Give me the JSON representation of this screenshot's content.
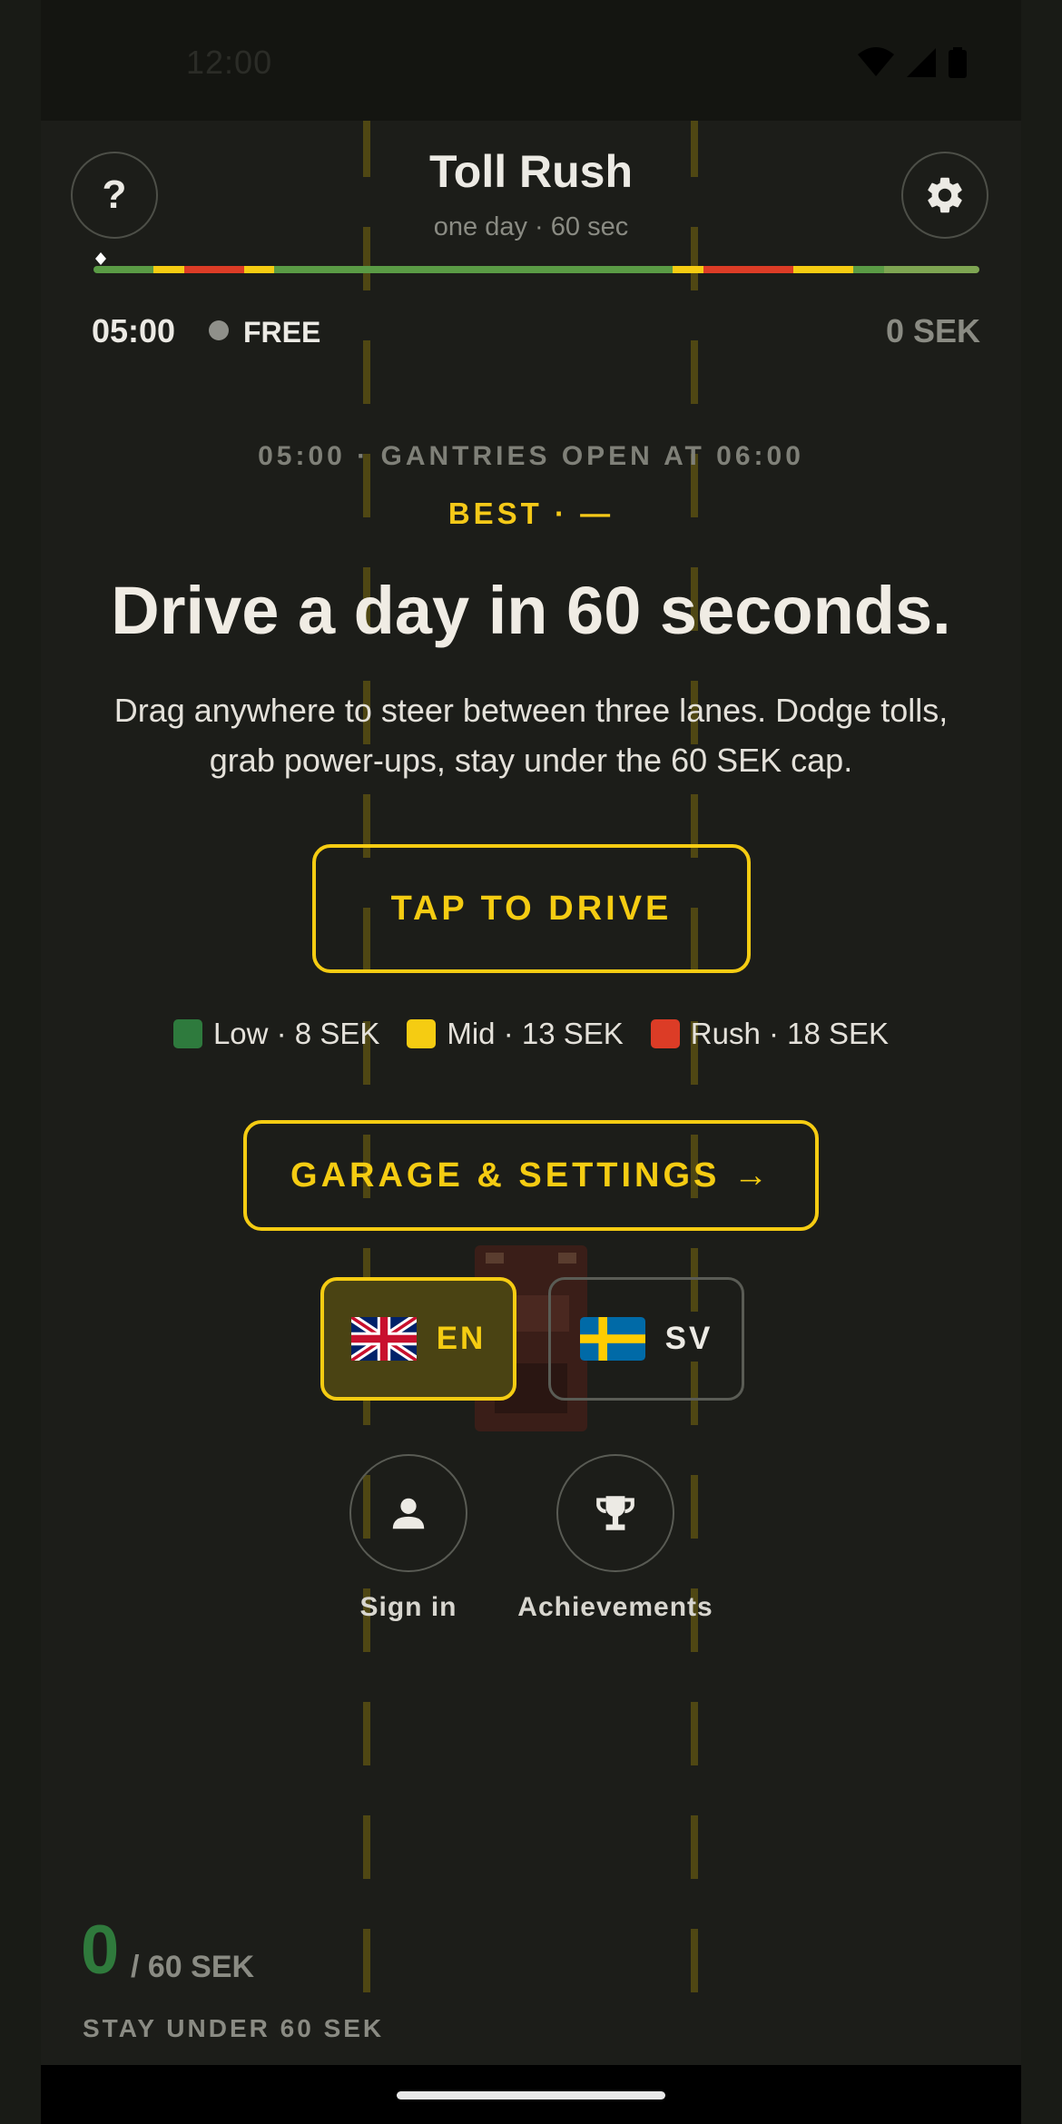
{
  "status_bar": {
    "time": "12:00",
    "icons": [
      "wifi-icon",
      "signal-icon",
      "battery-icon"
    ]
  },
  "header": {
    "help_label": "?",
    "title": "Toll Rush",
    "subtitle": "one day · 60 sec",
    "settings_icon": "gear-icon"
  },
  "timeline": {
    "segments": [
      {
        "tier": "low",
        "fraction": 0.068
      },
      {
        "tier": "mid",
        "fraction": 0.034
      },
      {
        "tier": "rush",
        "fraction": 0.068
      },
      {
        "tier": "mid",
        "fraction": 0.034
      },
      {
        "tier": "low",
        "fraction": 0.45
      },
      {
        "tier": "mid",
        "fraction": 0.034
      },
      {
        "tier": "rush",
        "fraction": 0.102
      },
      {
        "tier": "mid",
        "fraction": 0.068
      },
      {
        "tier": "low",
        "fraction": 0.034
      },
      {
        "tier": "low2",
        "fraction": 0.108
      }
    ],
    "progress": 0.0
  },
  "hud": {
    "time": "05:00",
    "tier": "FREE",
    "total": "0 SEK"
  },
  "intro": {
    "gantry_note": "05:00 · GANTRIES OPEN AT 06:00",
    "best": "BEST · —",
    "headline": "Drive a day in 60 seconds.",
    "description": "Drag anywhere to steer between three lanes. Dodge tolls, grab power-ups, stay under the 60 SEK cap."
  },
  "drive_button": "TAP TO DRIVE",
  "legend": [
    {
      "label": "Low · 8 SEK",
      "color": "#2e7a3d"
    },
    {
      "label": "Mid · 13 SEK",
      "color": "#f5cc12"
    },
    {
      "label": "Rush · 18 SEK",
      "color": "#dc3c26"
    }
  ],
  "garage_button": "GARAGE & SETTINGS →",
  "languages": [
    {
      "code": "EN",
      "flag": "uk-flag-icon",
      "selected": true
    },
    {
      "code": "SV",
      "flag": "sweden-flag-icon",
      "selected": false
    }
  ],
  "actions": [
    {
      "label": "Sign in",
      "icon": "person-icon"
    },
    {
      "label": "Achievements",
      "icon": "trophy-icon"
    }
  ],
  "footer": {
    "score": "0",
    "max": "/ 60 SEK",
    "goal": "STAY UNDER 60 SEK"
  },
  "colors": {
    "accent": "#f5cc12",
    "low": "#2e7a3d",
    "mid": "#f5cc12",
    "rush": "#dc3c26",
    "timeline_low": "#5a9b45",
    "timeline_low2": "#7ea552"
  }
}
